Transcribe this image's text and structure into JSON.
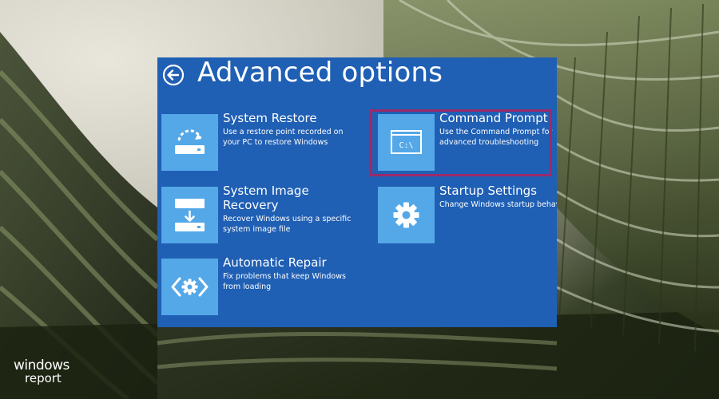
{
  "header": {
    "title": "Advanced options"
  },
  "tiles": [
    {
      "name": "System Restore",
      "description": "Use a restore point recorded on your PC to restore Windows",
      "icon": "system-restore-icon"
    },
    {
      "name": "Command Prompt",
      "description": "Use the Command Prompt for advanced troubleshooting",
      "icon": "command-prompt-icon",
      "icon_text": "C:\\"
    },
    {
      "name": "System Image Recovery",
      "description": "Recover Windows using a specific system image file",
      "icon": "system-image-recovery-icon"
    },
    {
      "name": "Startup Settings",
      "description": "Change Windows startup behavior",
      "icon": "gear-icon"
    },
    {
      "name": "Automatic Repair",
      "description": "Fix problems that keep Windows from loading",
      "icon": "automatic-repair-icon"
    }
  ],
  "watermark": {
    "line1": "windows",
    "line2": "report"
  },
  "colors": {
    "panel": "#1f5fb4",
    "tile_icon": "#54a8e8",
    "highlight": "#9b2a6a"
  }
}
